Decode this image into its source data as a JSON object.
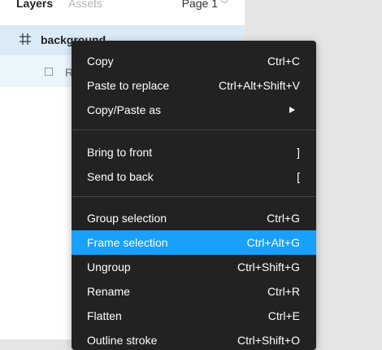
{
  "tabs": {
    "layers": "Layers",
    "assets": "Assets"
  },
  "page_select": {
    "label": "Page 1"
  },
  "layers": {
    "selected_name": "background",
    "child_name": "R"
  },
  "menu": {
    "copy": {
      "label": "Copy",
      "shortcut": "Ctrl+C"
    },
    "paste_replace": {
      "label": "Paste to replace",
      "shortcut": "Ctrl+Alt+Shift+V"
    },
    "copy_paste_as": {
      "label": "Copy/Paste as"
    },
    "bring_front": {
      "label": "Bring to front",
      "shortcut": "]"
    },
    "send_back": {
      "label": "Send to back",
      "shortcut": "["
    },
    "group": {
      "label": "Group selection",
      "shortcut": "Ctrl+G"
    },
    "frame": {
      "label": "Frame selection",
      "shortcut": "Ctrl+Alt+G"
    },
    "ungroup": {
      "label": "Ungroup",
      "shortcut": "Ctrl+Shift+G"
    },
    "rename": {
      "label": "Rename",
      "shortcut": "Ctrl+R"
    },
    "flatten": {
      "label": "Flatten",
      "shortcut": "Ctrl+E"
    },
    "outline": {
      "label": "Outline stroke",
      "shortcut": "Ctrl+Shift+O"
    }
  },
  "colors": {
    "menu_bg": "#222222",
    "highlight": "#18a0fb",
    "selected_row": "#daebf7"
  }
}
